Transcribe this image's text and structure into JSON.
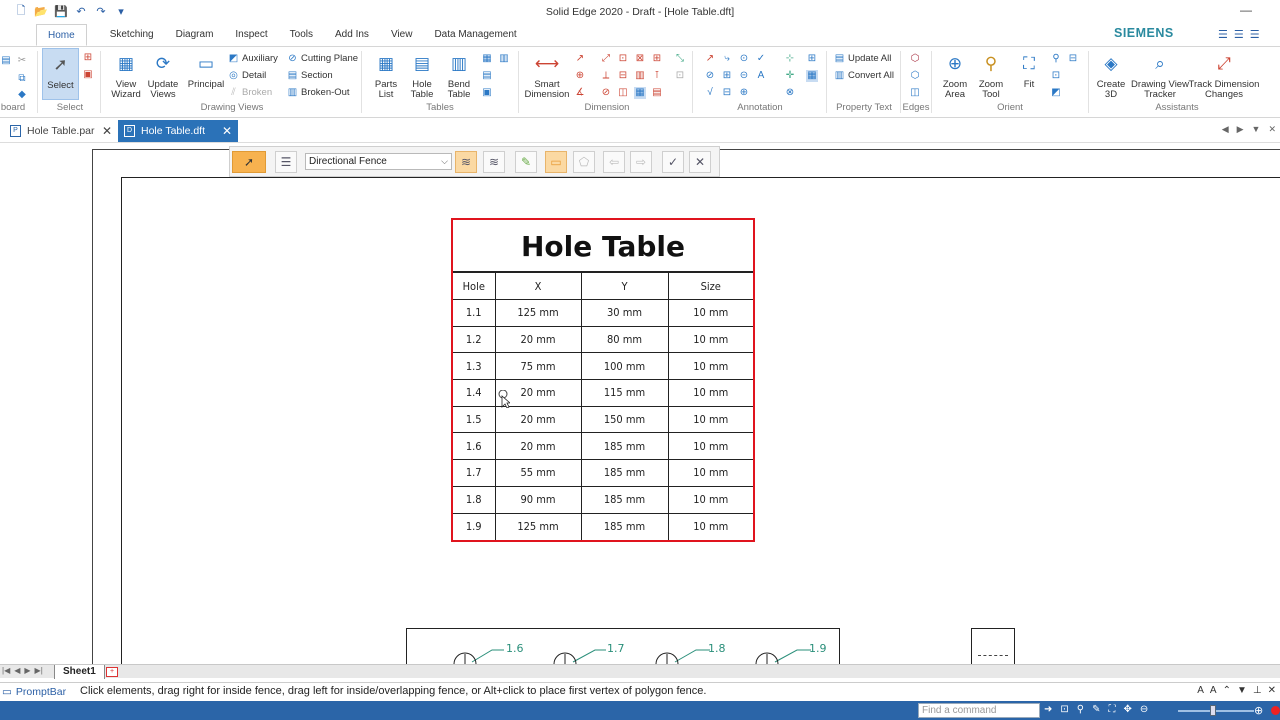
{
  "window": {
    "title": "Solid Edge 2020 - Draft - [Hole Table.dft]",
    "brand": "SIEMENS"
  },
  "ribbon_tabs": [
    "Home",
    "Sketching",
    "Diagram",
    "Inspect",
    "Tools",
    "Add Ins",
    "View",
    "Data Management"
  ],
  "ribbon": {
    "clipboard_label": "board",
    "select": {
      "button": "Select",
      "group": "Select"
    },
    "drawing_views": {
      "group": "Drawing Views",
      "view_wizard": "View\nWizard",
      "update_views": "Update\nViews",
      "principal": "Principal",
      "auxiliary": "Auxiliary",
      "detail": "Detail",
      "broken": "Broken",
      "cutting_plane": "Cutting Plane",
      "section": "Section",
      "broken_out": "Broken-Out"
    },
    "tables": {
      "group": "Tables",
      "parts_list": "Parts\nList",
      "hole_table": "Hole\nTable",
      "bend_table": "Bend\nTable"
    },
    "dimension": {
      "group": "Dimension",
      "smart_dimension": "Smart\nDimension"
    },
    "annotation": {
      "group": "Annotation"
    },
    "property_text": {
      "group": "Property Text",
      "update_all": "Update All",
      "convert_all": "Convert All"
    },
    "edges": {
      "group": "Edges"
    },
    "orient": {
      "group": "Orient",
      "zoom_area": "Zoom\nArea",
      "zoom_tool": "Zoom\nTool",
      "fit": "Fit"
    },
    "assistants": {
      "group": "Assistants",
      "create_3d": "Create\n3D",
      "drawing_view_tracker": "Drawing View\nTracker",
      "track_dimension_changes": "Track Dimension\nChanges"
    }
  },
  "doc_tabs": [
    {
      "label": "Hole Table.par",
      "active": false
    },
    {
      "label": "Hole Table.dft",
      "active": true
    }
  ],
  "command_bar": {
    "fence_mode": "Directional Fence"
  },
  "hole_table": {
    "title": "Hole Table",
    "columns": [
      "Hole",
      "X",
      "Y",
      "Size"
    ],
    "rows": [
      [
        "1.1",
        "125 mm",
        "30 mm",
        "10 mm"
      ],
      [
        "1.2",
        "20 mm",
        "80 mm",
        "10 mm"
      ],
      [
        "1.3",
        "75 mm",
        "100 mm",
        "10 mm"
      ],
      [
        "1.4",
        "20 mm",
        "115 mm",
        "10 mm"
      ],
      [
        "1.5",
        "20 mm",
        "150 mm",
        "10 mm"
      ],
      [
        "1.6",
        "20 mm",
        "185 mm",
        "10 mm"
      ],
      [
        "1.7",
        "55 mm",
        "185 mm",
        "10 mm"
      ],
      [
        "1.8",
        "90 mm",
        "185 mm",
        "10 mm"
      ],
      [
        "1.9",
        "125 mm",
        "185 mm",
        "10 mm"
      ]
    ]
  },
  "callouts": [
    "1.6",
    "1.7",
    "1.8",
    "1.9"
  ],
  "sheet_tabs": [
    "Sheet1"
  ],
  "prompt_bar": {
    "label": "PromptBar",
    "text": "Click elements, drag right for inside fence, drag left for inside/overlapping fence, or Alt+click to place first vertex of polygon fence."
  },
  "status_bar": {
    "find_placeholder": "Find a command"
  },
  "colors": {
    "accent_blue": "#2b65a8",
    "table_highlight": "#e0141e",
    "callout_teal": "#2a8f7a",
    "brand": "#2a8a9f"
  }
}
